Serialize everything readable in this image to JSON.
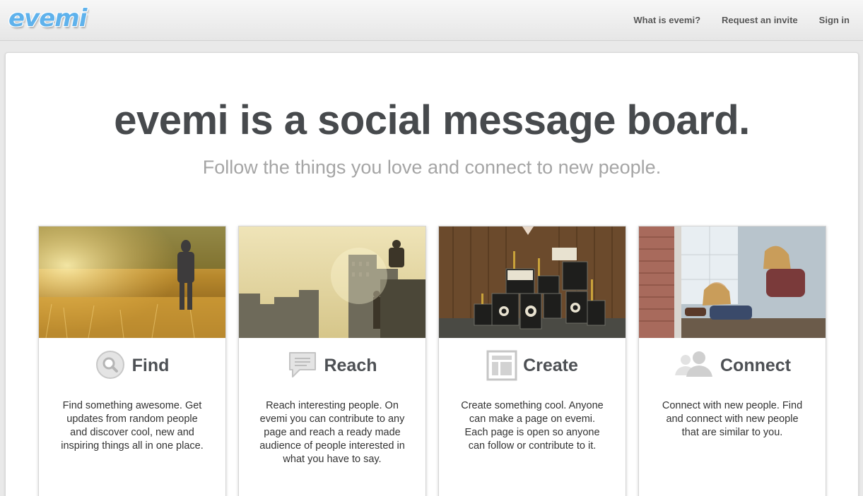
{
  "header": {
    "logo": "evemi",
    "nav": [
      "What is evemi?",
      "Request an invite",
      "Sign in"
    ]
  },
  "hero": {
    "headline": "evemi is a social message board.",
    "subheadline": "Follow the things you love and connect to new people."
  },
  "features": [
    {
      "title": "Find",
      "icon": "magnifier-icon",
      "description": "Find something awesome. Get updates from random people and discover cool, new and inspiring things all in one place."
    },
    {
      "title": "Reach",
      "icon": "speech-bubble-icon",
      "description": "Reach interesting people. On evemi you can contribute to any page and reach a ready made audience of people interested in what you have to say."
    },
    {
      "title": "Create",
      "icon": "page-layout-icon",
      "description": "Create something cool. Anyone can make a page on evemi. Each page is open so anyone can follow or contribute to it."
    },
    {
      "title": "Connect",
      "icon": "people-icon",
      "description": "Connect with new people. Find and connect with new people that are similar to you."
    }
  ],
  "colors": {
    "logo": "#5fb2ec",
    "headline": "#474a4d",
    "subheadline": "#a5a5a5",
    "icon": "#cfcfcf"
  }
}
